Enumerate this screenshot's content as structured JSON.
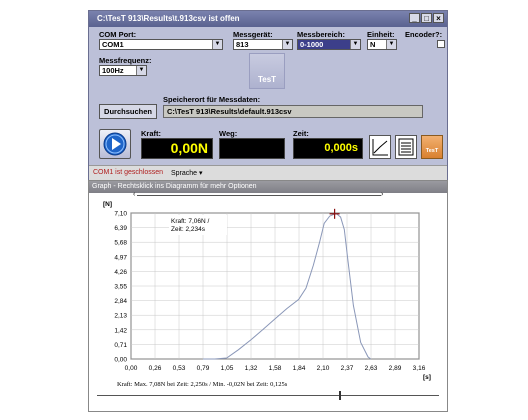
{
  "window": {
    "title": "C:\\TesT 913\\Results\\t.913csv ist offen"
  },
  "controls": {
    "com_port_label": "COM Port:",
    "com_port_value": "COM1",
    "messgeraet_label": "Messgerät:",
    "messgeraet_value": "813",
    "messbereich_label": "Messbereich:",
    "messbereich_value": "0-1000",
    "einheit_label": "Einheit:",
    "einheit_value": "N",
    "encoder_label": "Encoder?:",
    "messfrequenz_label": "Messfrequenz:",
    "messfrequenz_value": "100Hz",
    "logo_text": "TesT",
    "durchsuchen_label": "Durchsuchen",
    "speicherort_label": "Speicherort für Messdaten:",
    "speicherort_value": "C:\\TesT 913\\Results\\default.913csv"
  },
  "readouts": {
    "kraft_label": "Kraft:",
    "kraft_value": "0,00N",
    "weg_label": "Weg:",
    "weg_value": "",
    "zeit_label": "Zeit:",
    "zeit_value": "0,000s",
    "tool_logo": "TesT"
  },
  "status": {
    "port_status": "COM1 ist geschlossen",
    "sprache_label": "Sprache"
  },
  "graph": {
    "title": "Graph - Rechtsklick ins Diagramm für mehr Optionen",
    "y_unit": "[N]",
    "x_unit": "[s]",
    "annotation_line1": "Kraft: 7,06N /",
    "annotation_line2": "Zeit: 2,234s",
    "summary": "Kraft: Max. 7,08N bei Zeit: 2,250s / Min. -0,02N bei Zeit: 0,125s"
  },
  "chart_data": {
    "type": "line",
    "xlabel": "[s]",
    "ylabel": "[N]",
    "xlim": [
      0,
      3.16
    ],
    "ylim": [
      0,
      7.1
    ],
    "x_ticks": [
      "0,00",
      "0,26",
      "0,53",
      "0,79",
      "1,05",
      "1,32",
      "1,58",
      "1,84",
      "2,10",
      "2,37",
      "2,63",
      "2,89",
      "3,16"
    ],
    "y_ticks": [
      "0,00",
      "0,71",
      "1,42",
      "2,13",
      "2,84",
      "3,55",
      "4,26",
      "4,97",
      "5,68",
      "6,39",
      "7,10"
    ],
    "grid": true,
    "series": [
      {
        "x": [
          0.79,
          0.92,
          1.05,
          1.18,
          1.32,
          1.45,
          1.58,
          1.71,
          1.84,
          1.92,
          2.0,
          2.07,
          2.12,
          2.18,
          2.25,
          2.3,
          2.34,
          2.38,
          2.44,
          2.52,
          2.6,
          2.63
        ],
        "y": [
          0.0,
          0.0,
          0.05,
          0.45,
          0.95,
          1.45,
          1.95,
          2.45,
          2.9,
          3.45,
          4.55,
          5.7,
          6.6,
          6.95,
          7.08,
          6.9,
          6.3,
          4.8,
          2.6,
          0.8,
          0.1,
          0.0
        ]
      }
    ],
    "marker": {
      "x": 2.234,
      "y": 7.06
    }
  }
}
